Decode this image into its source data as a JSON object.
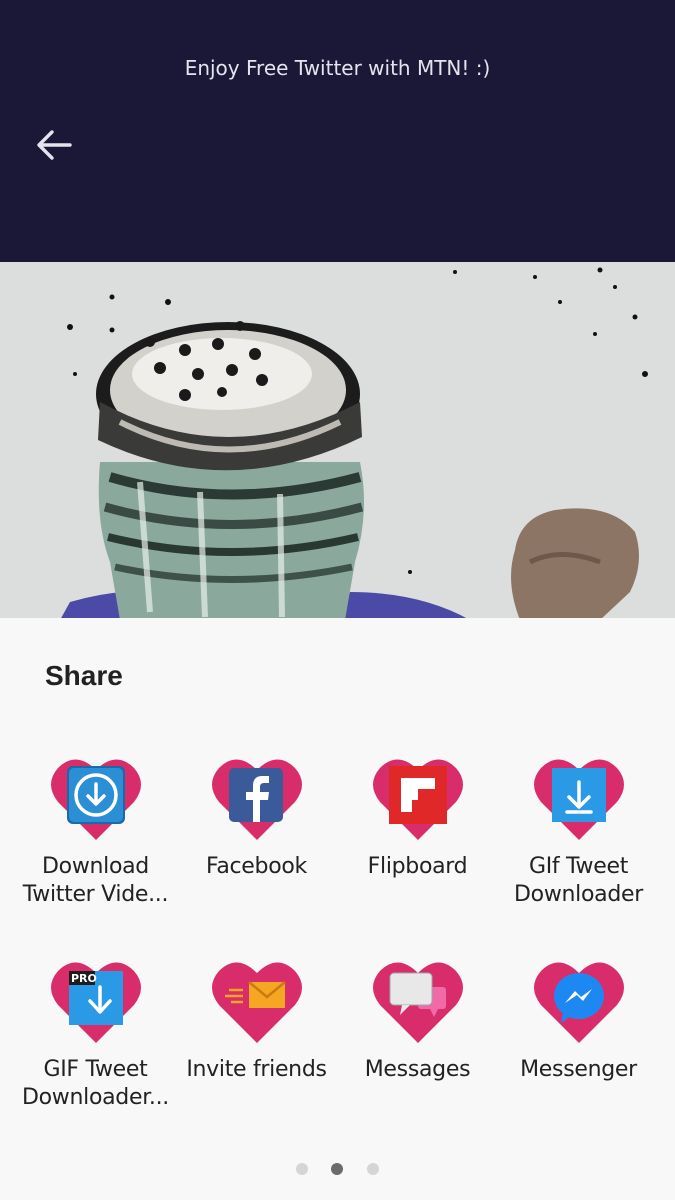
{
  "banner": {
    "text": "Enjoy Free Twitter with MTN! :)"
  },
  "header": {
    "back_icon": "arrow-left-icon"
  },
  "media": {
    "description_icon": "salt-shaker-photo"
  },
  "share": {
    "title": "Share",
    "heart_color": "#d92c6a",
    "items": [
      {
        "label": "Download Twitter Vide...",
        "icon": "download-circle-icon"
      },
      {
        "label": "Facebook",
        "icon": "facebook-icon"
      },
      {
        "label": "Flipboard",
        "icon": "flipboard-icon"
      },
      {
        "label": "GIf Tweet Downloader",
        "icon": "download-arrow-icon"
      },
      {
        "label": "GIF Tweet Downloader...",
        "icon": "pro-download-icon"
      },
      {
        "label": "Invite friends",
        "icon": "envelope-icon"
      },
      {
        "label": "Messages",
        "icon": "chat-bubbles-icon"
      },
      {
        "label": "Messenger",
        "icon": "messenger-icon"
      }
    ]
  },
  "pager": {
    "pages": 3,
    "active": 2
  }
}
